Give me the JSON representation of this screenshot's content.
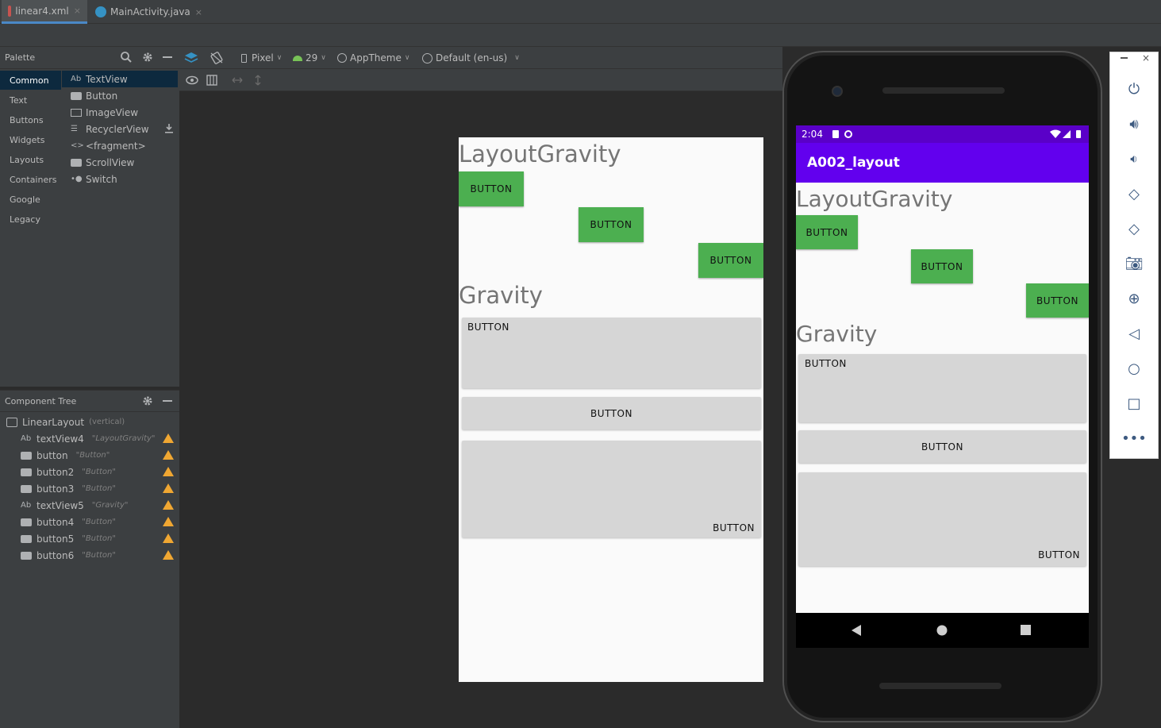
{
  "tabs": [
    {
      "label": "linear4.xml",
      "close": "×"
    },
    {
      "label": "MainActivity.java",
      "close": "×"
    }
  ],
  "palette": {
    "title": "Palette",
    "categories": [
      "Common",
      "Text",
      "Buttons",
      "Widgets",
      "Layouts",
      "Containers",
      "Google",
      "Legacy"
    ],
    "items": [
      "TextView",
      "Button",
      "ImageView",
      "RecyclerView",
      "<fragment>",
      "ScrollView",
      "Switch"
    ]
  },
  "toolbar": {
    "device": "Pixel",
    "api": "29",
    "theme": "AppTheme",
    "locale": "Default (en-us)"
  },
  "component_tree": {
    "title": "Component Tree",
    "root": {
      "name": "LinearLayout",
      "tag": "(vertical)"
    },
    "nodes": [
      {
        "name": "textView4",
        "tag": "\"LayoutGravity\""
      },
      {
        "name": "button",
        "tag": "\"Button\""
      },
      {
        "name": "button2",
        "tag": "\"Button\""
      },
      {
        "name": "button3",
        "tag": "\"Button\""
      },
      {
        "name": "textView5",
        "tag": "\"Gravity\""
      },
      {
        "name": "button4",
        "tag": "\"Button\""
      },
      {
        "name": "button5",
        "tag": "\"Button\""
      },
      {
        "name": "button6",
        "tag": "\"Button\""
      }
    ]
  },
  "preview": {
    "heading1": "LayoutGravity",
    "heading2": "Gravity",
    "button_label": "BUTTON"
  },
  "device": {
    "time": "2:04",
    "app_title": "A002_layout",
    "heading1": "LayoutGravity",
    "heading2": "Gravity",
    "button_label": "BUTTON"
  },
  "colors": {
    "accent": "#6200ee",
    "status": "#5a00c8",
    "button_green": "#4caf50",
    "warning": "#f0a732"
  }
}
